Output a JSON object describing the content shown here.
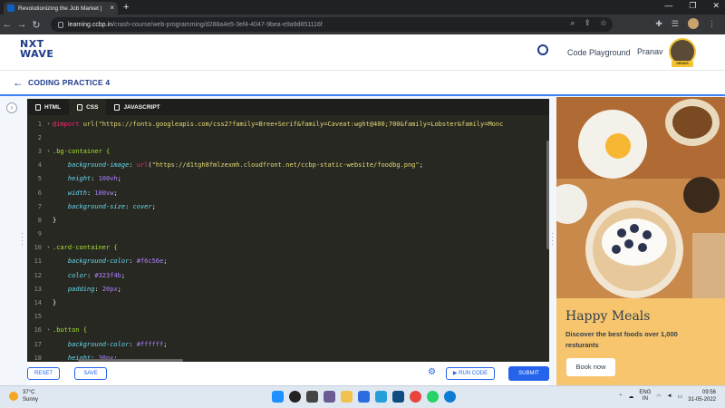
{
  "browser": {
    "tab_title": "Revolutionizing the Job Market |",
    "tab_close": "×",
    "new_tab": "+",
    "url_host": "learning.ccbp.in",
    "url_path": "/crash-course/web-programming/d288a4e5-3ef4-4047-9bea-e9a9d851116f",
    "window_controls": [
      "—",
      "❐",
      "✕"
    ]
  },
  "header": {
    "logo_line1": "NXT",
    "logo_line2": "WAVE",
    "code_playground": "Code Playground",
    "user_name": "Pranav",
    "badge": "GENIUS"
  },
  "subheader": {
    "back_icon": "←",
    "title": "CODING PRACTICE 4"
  },
  "editor": {
    "tabs": [
      {
        "label": "HTML",
        "active": false
      },
      {
        "label": "CSS",
        "active": true
      },
      {
        "label": "JAVASCRIPT",
        "active": false
      }
    ],
    "lines": [
      "@import url(\"https://fonts.googleapis.com/css2?family=Bree+Serif&family=Caveat:wght@400;700&family=Lobster&family=Monc",
      "",
      ".bg-container {",
      "    background-image: url(\"https://d1tgh8fmlzexmh.cloudfront.net/ccbp-static-website/foodbg.png\");",
      "    height: 100vh;",
      "    width: 100vw;",
      "    background-size: cover;",
      "}",
      "",
      ".card-container {",
      "    background-color: #f6c56e;",
      "    color: #323f4b;",
      "    padding: 20px;",
      "}",
      "",
      ".button {",
      "    background-color: #ffffff;",
      "    height: 38px;"
    ]
  },
  "actions": {
    "reset": "RESET",
    "save": "SAVE",
    "run_code": "▶ RUN CODE",
    "submit": "SUBMIT"
  },
  "preview": {
    "heading": "Happy Meals",
    "description": "Discover the best foods over 1,000 resturants",
    "button": "Book now",
    "bg_color": "#f6c56e",
    "text_color": "#323f4b"
  },
  "taskbar": {
    "temperature": "37°C",
    "weather": "Sunny",
    "lang1": "ENG",
    "lang2": "IN",
    "time": "09:56",
    "date": "31-05-2022"
  }
}
